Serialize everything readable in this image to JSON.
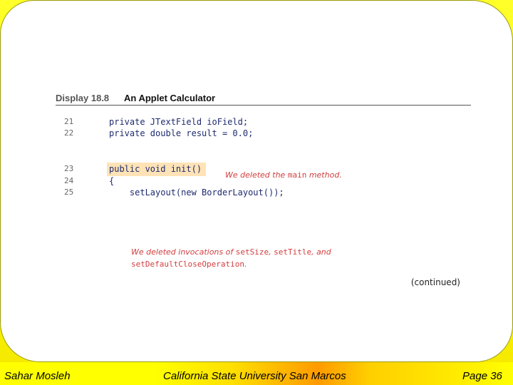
{
  "display": {
    "caption_number": "Display 18.8",
    "caption_title": "An Applet Calculator",
    "continued": "(continued)"
  },
  "code_lines": [
    {
      "number": "21",
      "text": "private JTextField ioField;"
    },
    {
      "number": "22",
      "text": "private double result = 0.0;"
    },
    {
      "number": "23",
      "text": "public void init()"
    },
    {
      "number": "24",
      "text": "{"
    },
    {
      "number": "25",
      "text": "    setLayout(new BorderLayout());"
    }
  ],
  "annotations": {
    "main_note_prefix": "We deleted the ",
    "main_note_code": "main",
    "main_note_suffix": " method.",
    "invocations_prefix": "We deleted invocations of ",
    "invocations_code1": "setSize",
    "invocations_sep1": ", ",
    "invocations_code2": "setTitle",
    "invocations_sep2": ", and",
    "invocations_code3": "setDefaultCloseOperation",
    "invocations_end": "."
  },
  "footer": {
    "author": "Sahar Mosleh",
    "institution": "California State University San Marcos",
    "page": "Page 36"
  },
  "colors": {
    "background": "#ffff00",
    "annotation": "#d23e3e",
    "highlight": "#ffe3b6"
  }
}
